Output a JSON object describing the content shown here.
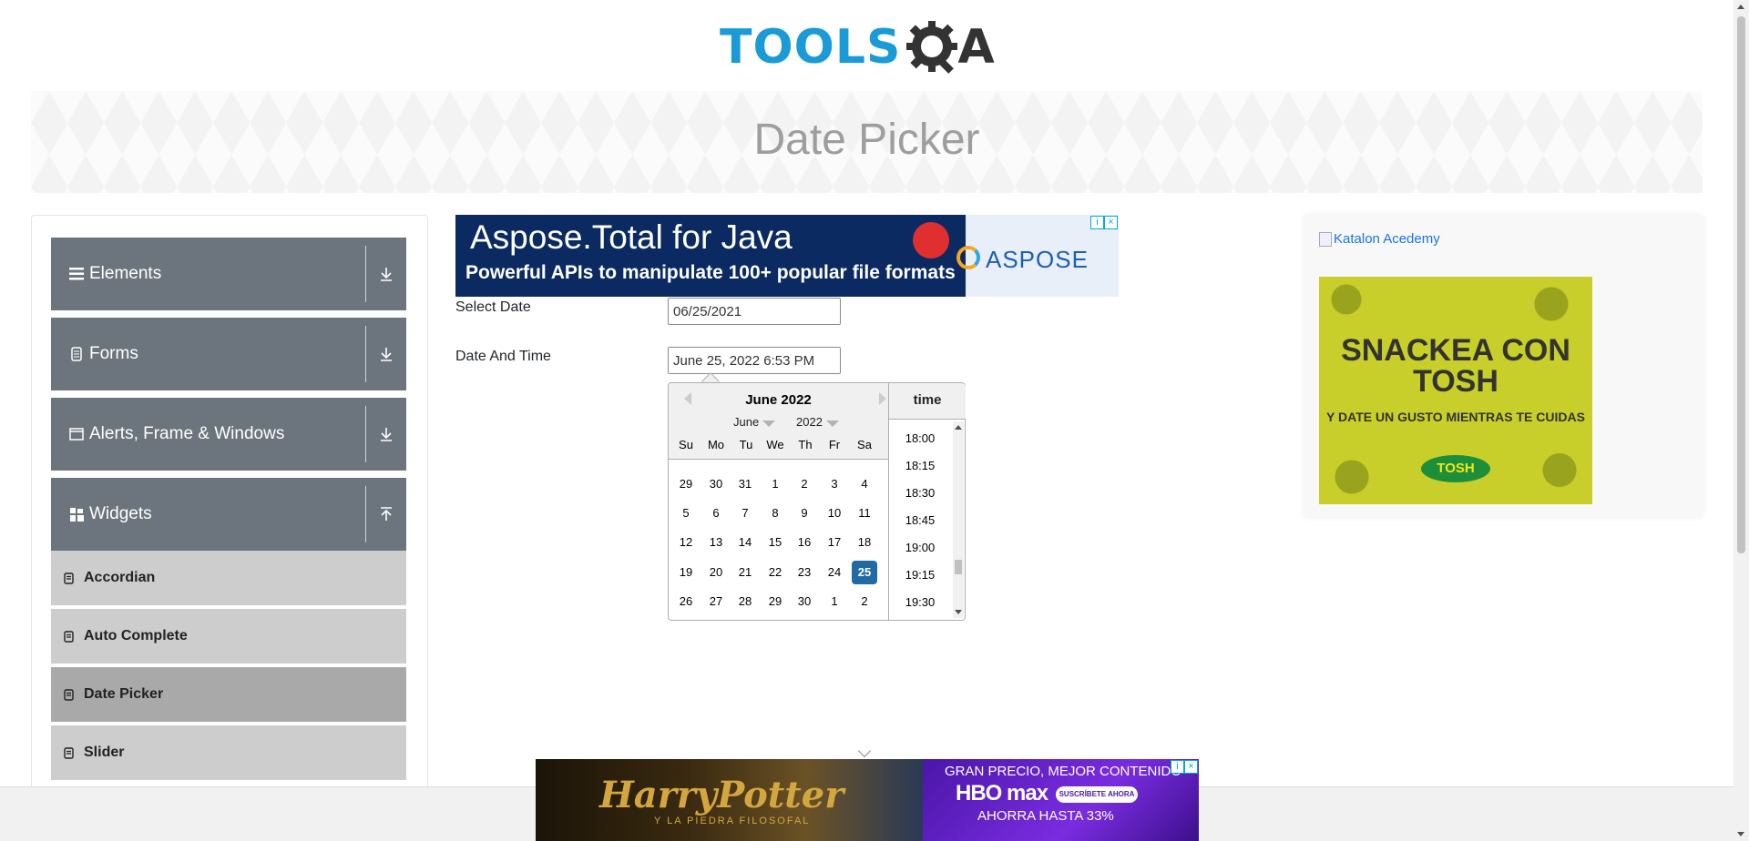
{
  "header": {
    "logo_text": "TOOLS",
    "logo_suffix": "A",
    "page_title": "Date Picker"
  },
  "sidebar": {
    "groups": [
      {
        "label": "Elements",
        "icon": "hamburger-icon"
      },
      {
        "label": "Forms",
        "icon": "document-icon"
      },
      {
        "label": "Alerts, Frame & Windows",
        "icon": "window-icon"
      },
      {
        "label": "Widgets",
        "icon": "grid-icon"
      }
    ],
    "widget_items": [
      {
        "label": "Accordian"
      },
      {
        "label": "Auto Complete"
      },
      {
        "label": "Date Picker"
      },
      {
        "label": "Slider"
      }
    ]
  },
  "ads": {
    "top": {
      "title": "Aspose.Total for Java",
      "subtitle": "Powerful APIs to manipulate 100+ popular file formats",
      "brand": "ASPOSE"
    },
    "right": {
      "alt_text": "Katalon Acedemy",
      "headline": "SNACKEA CON TOSH",
      "subline": "Y DATE UN GUSTO MIENTRAS TE CUIDAS",
      "brand": "TOSH"
    },
    "bottom": {
      "left_title": "HarryPotter",
      "left_sub": "Y LA PIEDRA FILOSOFAL",
      "line1": "GRAN PRECIO, MEJOR CONTENIDO",
      "brand": "HBO max",
      "cta": "SUSCRÍBETE AHORA",
      "line3": "AHORRA HASTA 33%"
    }
  },
  "form": {
    "select_date_label": "Select Date",
    "select_date_value": "06/25/2021",
    "date_time_label": "Date And Time",
    "date_time_value": "June 25, 2022 6:53 PM"
  },
  "picker": {
    "title": "June 2022",
    "month_select": "June",
    "year_select": "2022",
    "weekdays": [
      "Su",
      "Mo",
      "Tu",
      "We",
      "Th",
      "Fr",
      "Sa"
    ],
    "weeks": [
      [
        "29",
        "30",
        "31",
        "1",
        "2",
        "3",
        "4"
      ],
      [
        "5",
        "6",
        "7",
        "8",
        "9",
        "10",
        "11"
      ],
      [
        "12",
        "13",
        "14",
        "15",
        "16",
        "17",
        "18"
      ],
      [
        "19",
        "20",
        "21",
        "22",
        "23",
        "24",
        "25"
      ],
      [
        "26",
        "27",
        "28",
        "29",
        "30",
        "1",
        "2"
      ]
    ],
    "selected_day": "25",
    "time_header": "time",
    "times": [
      "18:00",
      "18:15",
      "18:30",
      "18:45",
      "19:00",
      "19:15",
      "19:30"
    ]
  }
}
